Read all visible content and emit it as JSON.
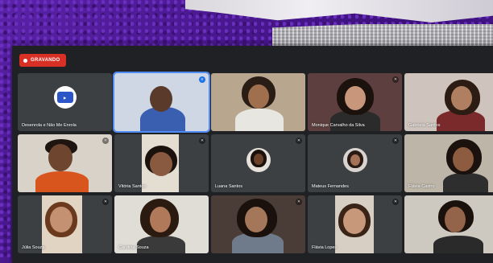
{
  "recording": {
    "label": "GRAVANDO"
  },
  "participants": [
    {
      "name": "Desenrola e Não Me Enrola"
    },
    {
      "name": ""
    },
    {
      "name": ""
    },
    {
      "name": "Monique Carvalho da Silva"
    },
    {
      "name": "Gabriela Santos"
    },
    {
      "name": ""
    },
    {
      "name": "Vitória Santos"
    },
    {
      "name": "Luana Santos"
    },
    {
      "name": "Mateus Fernandes"
    },
    {
      "name": "Flávia Castro"
    },
    {
      "name": "Júlia Souza"
    },
    {
      "name": "Carolina Souza"
    },
    {
      "name": ""
    },
    {
      "name": "Flávia Lopes"
    },
    {
      "name": ""
    }
  ],
  "colors": {
    "accent": "#4f8df5",
    "record": "#d93025",
    "tile": "#3c4043",
    "panel": "#202124"
  },
  "icons": {
    "mic": "mic-muted-icon",
    "record": "record-dot-icon",
    "logo": "organization-logo"
  }
}
